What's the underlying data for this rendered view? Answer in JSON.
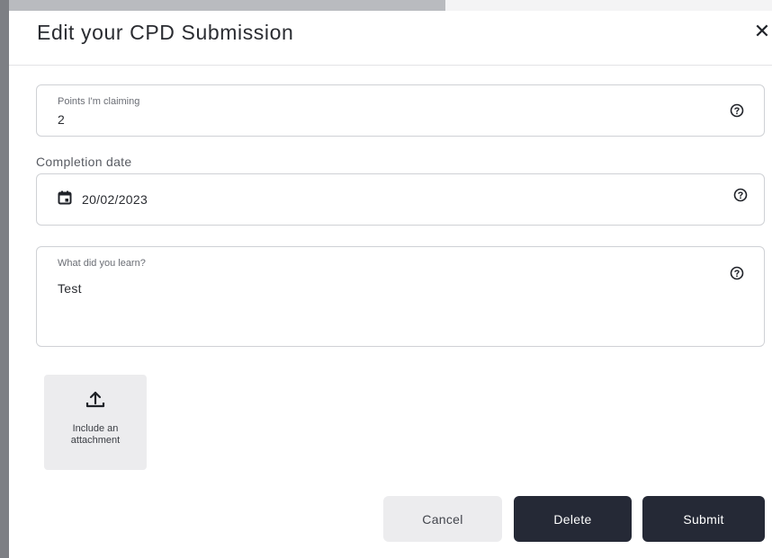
{
  "modal": {
    "title": "Edit your CPD Submission",
    "close_glyph": "✕"
  },
  "fields": {
    "points": {
      "label": "Points I'm claiming",
      "value": "2",
      "icon": "help-circle-icon"
    },
    "completion_date": {
      "label": "Completion date",
      "value": "20/02/2023",
      "icon": "calendar-icon",
      "help_icon": "help-circle-icon"
    },
    "learned": {
      "label": "What did you learn?",
      "value": "Test",
      "icon": "help-circle-icon"
    }
  },
  "attachment": {
    "label": "Include an attachment",
    "icon": "upload-icon"
  },
  "buttons": {
    "cancel": "Cancel",
    "delete": "Delete",
    "submit": "Submit"
  },
  "colors": {
    "primary_button": "#252936",
    "secondary_button": "#ececee",
    "backdrop": "#7d7f84"
  }
}
